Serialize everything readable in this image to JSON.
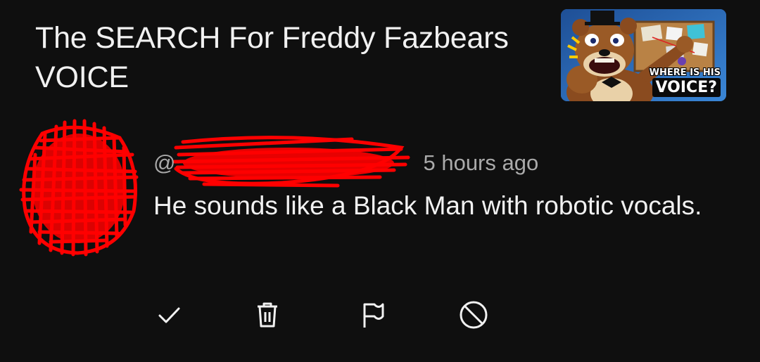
{
  "video": {
    "title": "The SEARCH For Freddy Fazbears VOICE",
    "thumbnail": {
      "caption_line1": "WHERE IS HIS",
      "caption_line2": "VOICE?"
    }
  },
  "comment": {
    "handle_prefix": "@",
    "handle_redacted": true,
    "timestamp": "5 hours ago",
    "text": "He sounds like a Black Man with robotic vocals.",
    "avatar_redacted": true
  },
  "actions": [
    {
      "icon": "check-icon",
      "name": "approve-button"
    },
    {
      "icon": "trash-icon",
      "name": "delete-button"
    },
    {
      "icon": "flag-icon",
      "name": "report-button"
    },
    {
      "icon": "block-icon",
      "name": "hide-user-button"
    }
  ],
  "colors": {
    "background": "#0f0f0f",
    "text_primary": "#f1f1f1",
    "text_secondary": "#aaaaaa",
    "redaction": "#ff0000"
  }
}
